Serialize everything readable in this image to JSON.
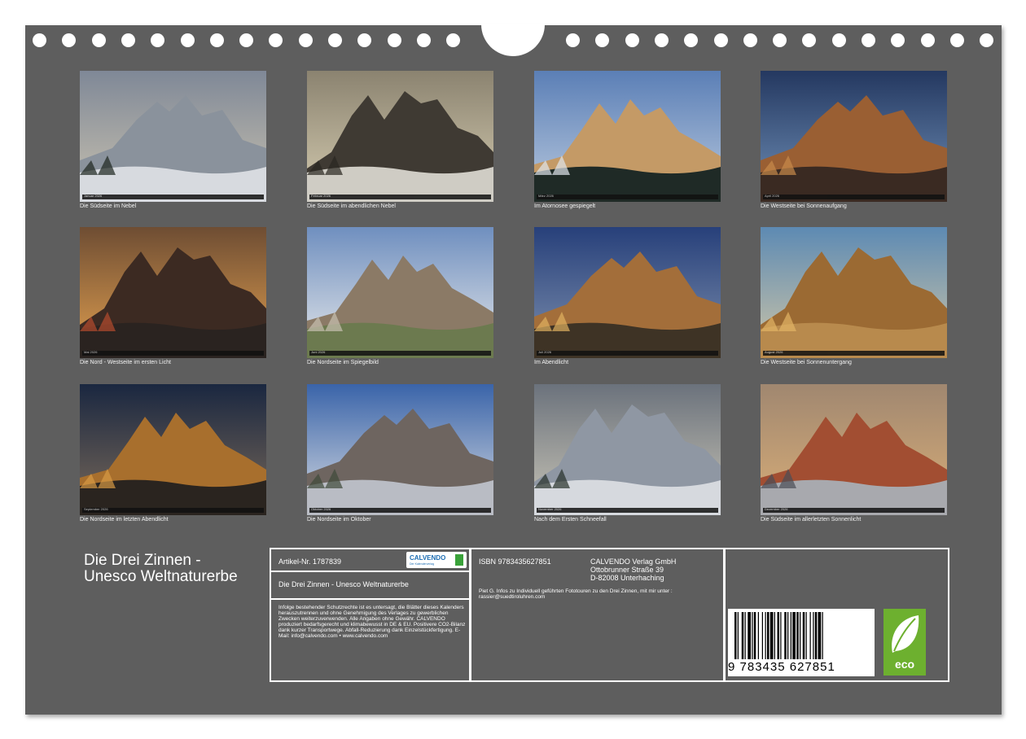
{
  "months": [
    {
      "name": "Januar 2026",
      "caption": "Die Südseite im Nebel",
      "palette": {
        "sky": "#7f8897",
        "sky2": "#c9c2b0",
        "mtn": "#8a929c",
        "ground": "#d7dadf",
        "accent": "#1e2620"
      }
    },
    {
      "name": "Februar 2026",
      "caption": "Die Südseite im abendlichen Nebel",
      "palette": {
        "sky": "#8b8370",
        "sky2": "#d4cbb0",
        "mtn": "#3f3a33",
        "ground": "#cfccc4",
        "accent": "#2a2621"
      }
    },
    {
      "name": "März 2026",
      "caption": "Im Atornosee gespiegelt",
      "palette": {
        "sky": "#5b7fb6",
        "sky2": "#b9c9de",
        "mtn": "#c49a66",
        "ground": "#1f2a26",
        "accent": "#e0e6ec"
      }
    },
    {
      "name": "April 2026",
      "caption": "Die Westseite bei Sonnenaufgang",
      "palette": {
        "sky": "#243860",
        "sky2": "#6f8fb7",
        "mtn": "#9a5f33",
        "ground": "#3a2a22",
        "accent": "#c88a4a"
      }
    },
    {
      "name": "Mai 2026",
      "caption": "Die Nord - Westseite im ersten Licht",
      "palette": {
        "sky": "#6e4d33",
        "sky2": "#e2a050",
        "mtn": "#3c2a22",
        "ground": "#2a2320",
        "accent": "#b54c2e"
      }
    },
    {
      "name": "Juni 2026",
      "caption": "Die Nordseite im Spiegelbild",
      "palette": {
        "sky": "#6f8fbf",
        "sky2": "#e6e8ea",
        "mtn": "#8b7a66",
        "ground": "#6c7a4f",
        "accent": "#c7c0b0"
      }
    },
    {
      "name": "Juli 2026",
      "caption": "Im Abendlicht",
      "palette": {
        "sky": "#27407a",
        "sky2": "#7d8fae",
        "mtn": "#a36e3a",
        "ground": "#3e3325",
        "accent": "#e0b060"
      }
    },
    {
      "name": "August 2026",
      "caption": "Die Westseite bei Sonnenuntergang",
      "palette": {
        "sky": "#5d8ab3",
        "sky2": "#cfc6a8",
        "mtn": "#9b6a33",
        "ground": "#b88a4d",
        "accent": "#e2b565"
      }
    },
    {
      "name": "September 2026",
      "caption": "Die Nordseite im letzten Abendlicht",
      "palette": {
        "sky": "#1a2740",
        "sky2": "#7a6a5a",
        "mtn": "#a86f2d",
        "ground": "#2a241f",
        "accent": "#d79a44"
      }
    },
    {
      "name": "Oktober 2026",
      "caption": "Die Nordseite im Oktober",
      "palette": {
        "sky": "#3a64a9",
        "sky2": "#d6dbe2",
        "mtn": "#6e6560",
        "ground": "#b9bcc4",
        "accent": "#3f4a3a"
      }
    },
    {
      "name": "November 2026",
      "caption": "Nach dem Ersten Schneefall",
      "palette": {
        "sky": "#6b727c",
        "sky2": "#c9c5b7",
        "mtn": "#8f97a3",
        "ground": "#d6d9de",
        "accent": "#27302a"
      }
    },
    {
      "name": "Dezember 2026",
      "caption": "Die Südseite im allerletzten Sonnenlicht",
      "palette": {
        "sky": "#a08770",
        "sky2": "#d9ae78",
        "mtn": "#a24e32",
        "ground": "#a8a9ae",
        "accent": "#4a4d56"
      }
    }
  ],
  "title": {
    "line1": "Die Drei Zinnen -",
    "line2": "Unesco Weltnaturerbe"
  },
  "info": {
    "artikel": "Artikel-Nr. 1787839",
    "logo_text": "CALVENDO",
    "logo_sub": "Der Kalenderverlag",
    "calendar_title": "Die Drei Zinnen - Unesco Weltnaturerbe",
    "legal": "Infolge bestehender Schutzrechte ist es untersagt, die Blätter dieses Kalenders herauszutrennen und ohne Genehmigung des Verlages zu gewerblichen Zwecken weiterzuverwenden. Alle Angaben ohne Gewähr. CALVENDO produziert bedarfsgerecht und klimabewusst in DE & EU. Positivere CO2-Bilanz dank kurzer Transportwege. Abfall-Reduzierung dank Einzelstückfertigung. E-Mail: info@calvendo.com • www.calvendo.com",
    "isbn": "ISBN 9783435627851",
    "publisher1": "CALVENDO Verlag GmbH",
    "publisher2": "Ottobrunner Straße 39",
    "publisher3": "D-82008 Unterhaching",
    "author_note": "Piet G. Infos zu Individuell geführten Fototouren zu den Drei Zinnen, mit mir unter : rassier@suedtiroluhren.com",
    "barcode_digits": "9 783435 627851",
    "eco_label": "eco"
  }
}
